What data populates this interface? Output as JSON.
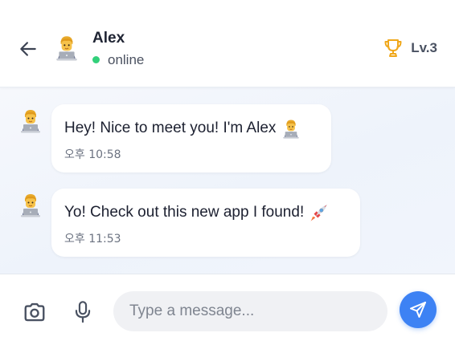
{
  "header": {
    "contact_name": "Alex",
    "status": "online",
    "level": "Lv.3",
    "avatar_icon": "technologist-emoji"
  },
  "messages": [
    {
      "text": "Hey! Nice to meet you! I'm Alex",
      "emoji": "technologist-emoji",
      "time": "오후 10:58"
    },
    {
      "text": "Yo! Check out this new app I found!",
      "emoji": "rocket-emoji",
      "time": "오후 11:53"
    }
  ],
  "input": {
    "placeholder": "Type a message...",
    "value": ""
  },
  "colors": {
    "accent": "#3d82f4",
    "online": "#32d07a",
    "trophy": "#f0a81c"
  }
}
